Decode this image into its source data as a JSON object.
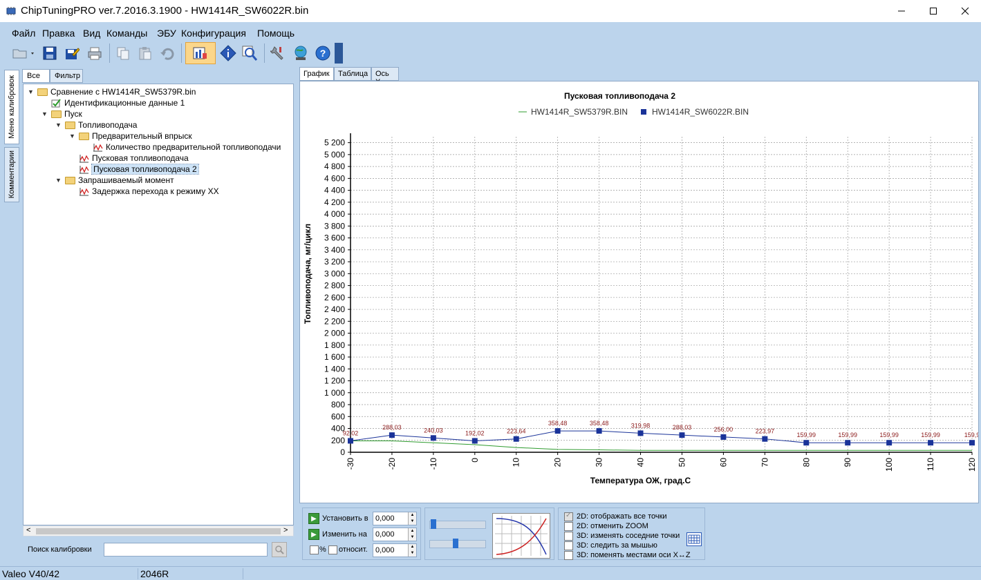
{
  "window": {
    "title": "ChipTuningPRO ver.7.2016.3.1900 - HW1414R_SW6022R.bin"
  },
  "menu": [
    "Файл",
    "Правка",
    "Вид",
    "Команды",
    "ЭБУ",
    "Конфигурация",
    "Помощь"
  ],
  "toolbar_icons": [
    "open-folder-icon",
    "save-icon",
    "edit-save-icon",
    "print-icon",
    "copy-icon",
    "paste-icon",
    "undo-icon",
    "compare-chart-icon",
    "info-icon",
    "search-table-icon",
    "settings-icon",
    "network-icon",
    "help-icon"
  ],
  "left_vtabs": [
    "Меню калибровок",
    "Комментарии"
  ],
  "filter_tabs": [
    "Все",
    "Фильтр"
  ],
  "tree": [
    {
      "label": "Сравнение с HW1414R_SW5379R.bin",
      "type": "folder",
      "level": 0
    },
    {
      "label": "Идентификационные данные 1",
      "type": "id",
      "level": 1
    },
    {
      "label": "Пуск",
      "type": "folder",
      "level": 1
    },
    {
      "label": "Топливоподача",
      "type": "folder",
      "level": 2
    },
    {
      "label": "Предварительный впрыск",
      "type": "folder",
      "level": 3
    },
    {
      "label": "Количество предварительной топливоподачи",
      "type": "calib",
      "level": 4
    },
    {
      "label": "Пусковая топливоподача",
      "type": "calib",
      "level": 3
    },
    {
      "label": "Пусковая топливоподача 2",
      "type": "calib",
      "level": 3,
      "selected": true
    },
    {
      "label": "Запрашиваемый момент",
      "type": "folder",
      "level": 2
    },
    {
      "label": "Задержка перехода к режиму XX",
      "type": "calib",
      "level": 3
    }
  ],
  "search": {
    "label": "Поиск калибровки",
    "value": ""
  },
  "right_tabs": [
    "График",
    "Таблица",
    "Ось X"
  ],
  "chart_data": {
    "type": "line",
    "title": "Пусковая топливоподача 2",
    "xlabel": "Температура ОЖ, град.С",
    "ylabel": "Топливоподача, мг/цикл",
    "x": [
      -30,
      -20,
      -10,
      0,
      10,
      20,
      30,
      40,
      50,
      60,
      70,
      80,
      90,
      100,
      110,
      120
    ],
    "xlim": [
      -30,
      120
    ],
    "ylim": [
      0,
      5300
    ],
    "yticks": [
      "0",
      "200",
      "400",
      "600",
      "800",
      "1 000",
      "1 200",
      "1 400",
      "1 600",
      "1 800",
      "2 000",
      "2 200",
      "2 400",
      "2 600",
      "2 800",
      "3 000",
      "3 200",
      "3 400",
      "3 600",
      "3 800",
      "4 000",
      "4 200",
      "4 400",
      "4 600",
      "4 800",
      "5 000",
      "5 200"
    ],
    "xticks": [
      "-30",
      "-20",
      "-10",
      "0",
      "10",
      "20",
      "30",
      "40",
      "50",
      "60",
      "70",
      "80",
      "90",
      "100",
      "110",
      "120"
    ],
    "legend_position": "top",
    "grid": true,
    "series": [
      {
        "name": "HW1414R_SW5379R.BIN",
        "color": "#2e9b2e",
        "marker": false,
        "values": [
          192,
          192,
          160,
          128,
          80,
          48,
          40,
          32,
          32,
          32,
          32,
          32,
          32,
          32,
          32,
          32
        ]
      },
      {
        "name": "HW1414R_SW6022R.BIN",
        "color": "#1a3399",
        "marker": true,
        "values": [
          192.02,
          288.03,
          240.03,
          192.02,
          223.64,
          358.48,
          358.48,
          319.98,
          288.03,
          256.0,
          223.97,
          159.99,
          159.99,
          159.99,
          159.99,
          159.99
        ],
        "labels": [
          "92,02",
          "288,03",
          "240,03",
          "192,02",
          "223,64",
          "358,48",
          "358,48",
          "319,98",
          "288,03",
          "256,00",
          "223,97",
          "159,99",
          "159,99",
          "159,99",
          "159,99",
          "159,9"
        ]
      }
    ]
  },
  "controls": {
    "set_to_label": "Установить в",
    "set_to_value": "0,000",
    "change_by_label": "Изменить на",
    "change_by_value": "0,000",
    "percent_label": "%",
    "relative_label": "относит.",
    "relative_value": "0,000",
    "options": [
      {
        "label": "2D: отображать все точки",
        "checked": true
      },
      {
        "label": "2D: отменить ZOOM",
        "checked": false
      },
      {
        "label": "3D: изменять соседние точки",
        "checked": false
      },
      {
        "label": "3D: следить за мышью",
        "checked": false
      },
      {
        "label": "3D: поменять местами оси X↔Z",
        "checked": false
      }
    ]
  },
  "status": [
    "Valeo V40/42",
    "2046R"
  ]
}
